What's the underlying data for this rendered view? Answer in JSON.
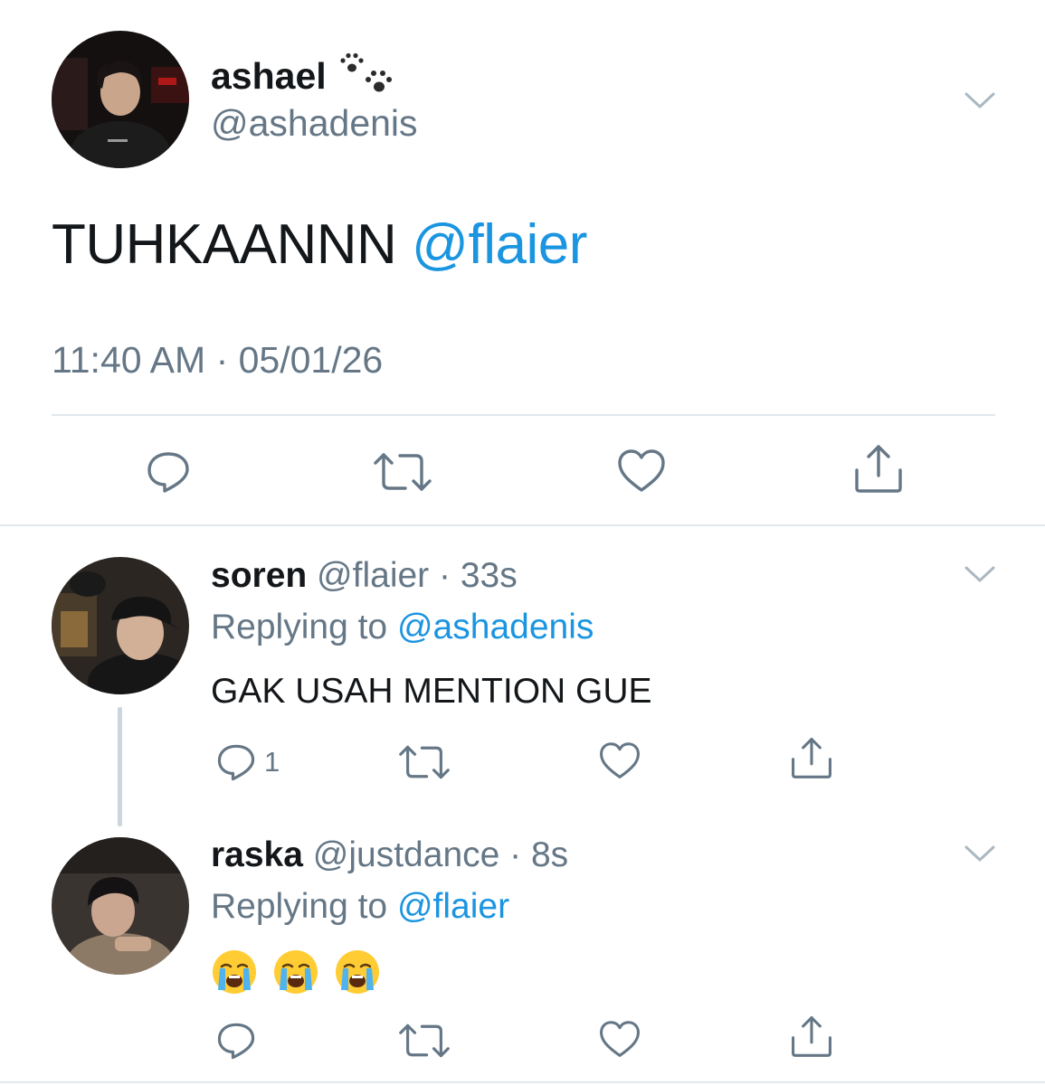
{
  "main_tweet": {
    "name": "ashael",
    "handle": "@ashadenis",
    "text": "TUHKAANNN",
    "mention": "@flaier",
    "timestamp": "11:40 AM · 05/01/26",
    "actions": [
      "reply-icon",
      "retweet-icon",
      "like-icon",
      "share-icon"
    ]
  },
  "replies": [
    {
      "name": "soren",
      "handle": "@flaier",
      "time": "· 33s",
      "replying_label": "Replying to",
      "replying_to": "@ashadenis",
      "text": "GAK USAH MENTION GUE",
      "reply_count": "1"
    },
    {
      "name": "raska",
      "handle": "@justdance",
      "time": "· 8s",
      "replying_label": "Replying to",
      "replying_to": "@flaier",
      "emojis": [
        "loudly-crying-face",
        "loudly-crying-face",
        "loudly-crying-face"
      ]
    }
  ],
  "colors": {
    "link": "#1b95e0",
    "secondary": "#657786",
    "divider": "#e1e8ed"
  }
}
